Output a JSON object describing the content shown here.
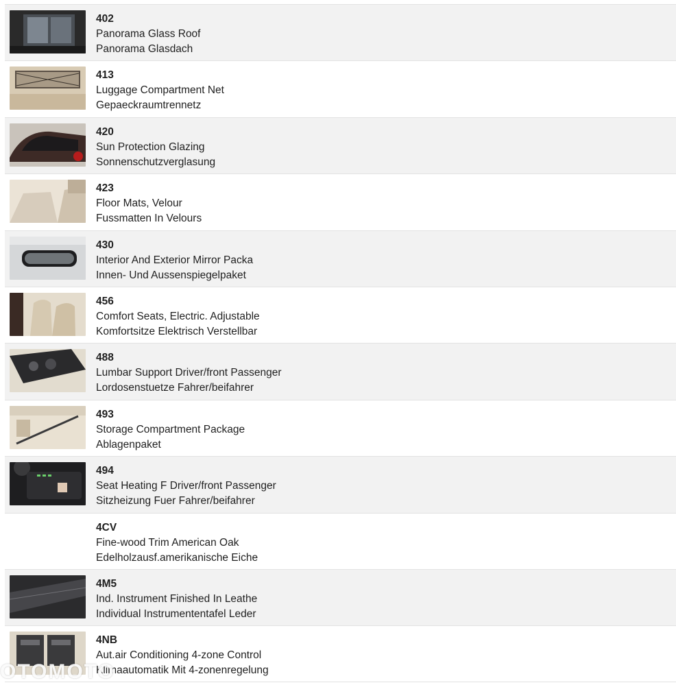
{
  "options": [
    {
      "code": "402",
      "name_en": "Panorama Glass Roof",
      "name_de": "Panorama Glasdach",
      "icon": "panorama-roof-photo",
      "has_image": true
    },
    {
      "code": "413",
      "name_en": "Luggage Compartment Net",
      "name_de": "Gepaeckraumtrennetz",
      "icon": "luggage-net-photo",
      "has_image": true
    },
    {
      "code": "420",
      "name_en": "Sun Protection Glazing",
      "name_de": "Sonnenschutzverglasung",
      "icon": "tinted-glazing-photo",
      "has_image": true
    },
    {
      "code": "423",
      "name_en": "Floor Mats, Velour",
      "name_de": "Fussmatten In Velours",
      "icon": "floor-mats-photo",
      "has_image": true
    },
    {
      "code": "430",
      "name_en": "Interior And Exterior Mirror Packa",
      "name_de": "Innen- Und Aussenspiegelpaket",
      "icon": "mirror-photo",
      "has_image": true
    },
    {
      "code": "456",
      "name_en": "Comfort Seats, Electric. Adjustable",
      "name_de": "Komfortsitze Elektrisch Verstellbar",
      "icon": "comfort-seats-photo",
      "has_image": true
    },
    {
      "code": "488",
      "name_en": "Lumbar Support Driver/front Passenger",
      "name_de": "Lordosenstuetze Fahrer/beifahrer",
      "icon": "lumbar-controls-photo",
      "has_image": true
    },
    {
      "code": "493",
      "name_en": "Storage Compartment Package",
      "name_de": "Ablagenpaket",
      "icon": "storage-rail-photo",
      "has_image": true
    },
    {
      "code": "494",
      "name_en": "Seat Heating F Driver/front Passenger",
      "name_de": "Sitzheizung Fuer Fahrer/beifahrer",
      "icon": "seat-heating-controls-photo",
      "has_image": true
    },
    {
      "code": "4CV",
      "name_en": "Fine-wood Trim American Oak",
      "name_de": "Edelholzausf.amerikanische Eiche",
      "icon": "",
      "has_image": false
    },
    {
      "code": "4M5",
      "name_en": "Ind. Instrument Finished In Leathe",
      "name_de": "Individual Instrumententafel Leder",
      "icon": "leather-dashboard-photo",
      "has_image": true
    },
    {
      "code": "4NB",
      "name_en": "Aut.air Conditioning 4-zone Control",
      "name_de": "Klimaautomatik Mit 4-zonenregelung",
      "icon": "climate-control-photo",
      "has_image": true
    }
  ],
  "watermark": {
    "text": "OTOMOTO"
  },
  "colors": {
    "row_alt": "#f2f2f2",
    "row_plain": "#ffffff",
    "divider": "#e2e2e2",
    "text": "#1f1f1f"
  }
}
